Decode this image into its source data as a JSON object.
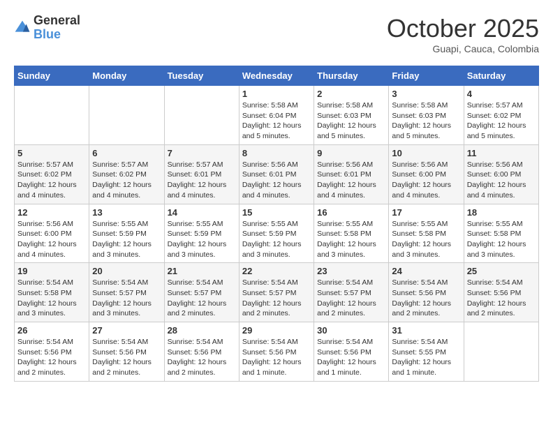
{
  "header": {
    "logo_line1": "General",
    "logo_line2": "Blue",
    "month": "October 2025",
    "location": "Guapi, Cauca, Colombia"
  },
  "days_of_week": [
    "Sunday",
    "Monday",
    "Tuesday",
    "Wednesday",
    "Thursday",
    "Friday",
    "Saturday"
  ],
  "weeks": [
    [
      {
        "day": "",
        "info": ""
      },
      {
        "day": "",
        "info": ""
      },
      {
        "day": "",
        "info": ""
      },
      {
        "day": "1",
        "info": "Sunrise: 5:58 AM\nSunset: 6:04 PM\nDaylight: 12 hours\nand 5 minutes."
      },
      {
        "day": "2",
        "info": "Sunrise: 5:58 AM\nSunset: 6:03 PM\nDaylight: 12 hours\nand 5 minutes."
      },
      {
        "day": "3",
        "info": "Sunrise: 5:58 AM\nSunset: 6:03 PM\nDaylight: 12 hours\nand 5 minutes."
      },
      {
        "day": "4",
        "info": "Sunrise: 5:57 AM\nSunset: 6:02 PM\nDaylight: 12 hours\nand 5 minutes."
      }
    ],
    [
      {
        "day": "5",
        "info": "Sunrise: 5:57 AM\nSunset: 6:02 PM\nDaylight: 12 hours\nand 4 minutes."
      },
      {
        "day": "6",
        "info": "Sunrise: 5:57 AM\nSunset: 6:02 PM\nDaylight: 12 hours\nand 4 minutes."
      },
      {
        "day": "7",
        "info": "Sunrise: 5:57 AM\nSunset: 6:01 PM\nDaylight: 12 hours\nand 4 minutes."
      },
      {
        "day": "8",
        "info": "Sunrise: 5:56 AM\nSunset: 6:01 PM\nDaylight: 12 hours\nand 4 minutes."
      },
      {
        "day": "9",
        "info": "Sunrise: 5:56 AM\nSunset: 6:01 PM\nDaylight: 12 hours\nand 4 minutes."
      },
      {
        "day": "10",
        "info": "Sunrise: 5:56 AM\nSunset: 6:00 PM\nDaylight: 12 hours\nand 4 minutes."
      },
      {
        "day": "11",
        "info": "Sunrise: 5:56 AM\nSunset: 6:00 PM\nDaylight: 12 hours\nand 4 minutes."
      }
    ],
    [
      {
        "day": "12",
        "info": "Sunrise: 5:56 AM\nSunset: 6:00 PM\nDaylight: 12 hours\nand 4 minutes."
      },
      {
        "day": "13",
        "info": "Sunrise: 5:55 AM\nSunset: 5:59 PM\nDaylight: 12 hours\nand 3 minutes."
      },
      {
        "day": "14",
        "info": "Sunrise: 5:55 AM\nSunset: 5:59 PM\nDaylight: 12 hours\nand 3 minutes."
      },
      {
        "day": "15",
        "info": "Sunrise: 5:55 AM\nSunset: 5:59 PM\nDaylight: 12 hours\nand 3 minutes."
      },
      {
        "day": "16",
        "info": "Sunrise: 5:55 AM\nSunset: 5:58 PM\nDaylight: 12 hours\nand 3 minutes."
      },
      {
        "day": "17",
        "info": "Sunrise: 5:55 AM\nSunset: 5:58 PM\nDaylight: 12 hours\nand 3 minutes."
      },
      {
        "day": "18",
        "info": "Sunrise: 5:55 AM\nSunset: 5:58 PM\nDaylight: 12 hours\nand 3 minutes."
      }
    ],
    [
      {
        "day": "19",
        "info": "Sunrise: 5:54 AM\nSunset: 5:58 PM\nDaylight: 12 hours\nand 3 minutes."
      },
      {
        "day": "20",
        "info": "Sunrise: 5:54 AM\nSunset: 5:57 PM\nDaylight: 12 hours\nand 3 minutes."
      },
      {
        "day": "21",
        "info": "Sunrise: 5:54 AM\nSunset: 5:57 PM\nDaylight: 12 hours\nand 2 minutes."
      },
      {
        "day": "22",
        "info": "Sunrise: 5:54 AM\nSunset: 5:57 PM\nDaylight: 12 hours\nand 2 minutes."
      },
      {
        "day": "23",
        "info": "Sunrise: 5:54 AM\nSunset: 5:57 PM\nDaylight: 12 hours\nand 2 minutes."
      },
      {
        "day": "24",
        "info": "Sunrise: 5:54 AM\nSunset: 5:56 PM\nDaylight: 12 hours\nand 2 minutes."
      },
      {
        "day": "25",
        "info": "Sunrise: 5:54 AM\nSunset: 5:56 PM\nDaylight: 12 hours\nand 2 minutes."
      }
    ],
    [
      {
        "day": "26",
        "info": "Sunrise: 5:54 AM\nSunset: 5:56 PM\nDaylight: 12 hours\nand 2 minutes."
      },
      {
        "day": "27",
        "info": "Sunrise: 5:54 AM\nSunset: 5:56 PM\nDaylight: 12 hours\nand 2 minutes."
      },
      {
        "day": "28",
        "info": "Sunrise: 5:54 AM\nSunset: 5:56 PM\nDaylight: 12 hours\nand 2 minutes."
      },
      {
        "day": "29",
        "info": "Sunrise: 5:54 AM\nSunset: 5:56 PM\nDaylight: 12 hours\nand 1 minute."
      },
      {
        "day": "30",
        "info": "Sunrise: 5:54 AM\nSunset: 5:56 PM\nDaylight: 12 hours\nand 1 minute."
      },
      {
        "day": "31",
        "info": "Sunrise: 5:54 AM\nSunset: 5:55 PM\nDaylight: 12 hours\nand 1 minute."
      },
      {
        "day": "",
        "info": ""
      }
    ]
  ]
}
